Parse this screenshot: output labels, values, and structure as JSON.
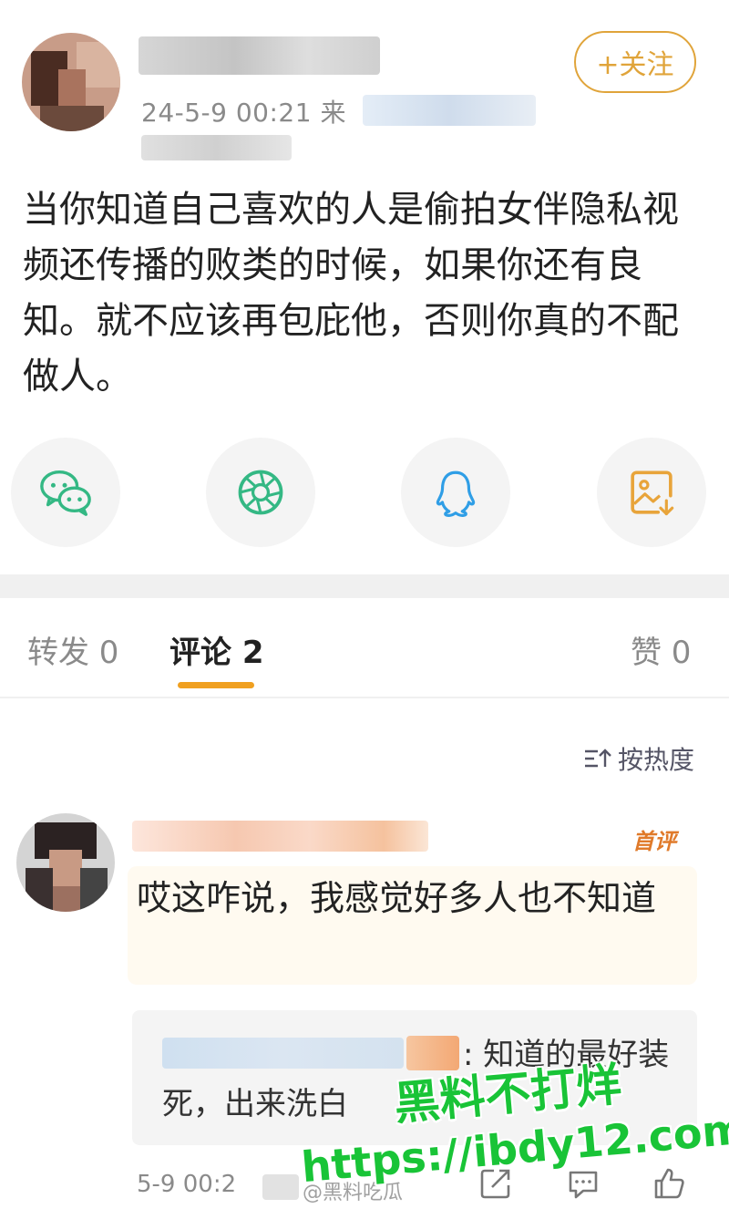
{
  "post": {
    "timestamp": "24-5-9 00:21",
    "source_prefix": "来",
    "follow_label": "+关注",
    "body": "当你知道自己喜欢的人是偷拍女伴隐私视频还传播的败类的时候，如果你还有良知。就不应该再包庇他，否则你真的不配做人。"
  },
  "share": {
    "items": [
      {
        "name": "wechat-icon",
        "color": "#34b884"
      },
      {
        "name": "moments-icon",
        "color": "#34b884"
      },
      {
        "name": "qq-icon",
        "color": "#2f9ee6"
      },
      {
        "name": "save-image-icon",
        "color": "#e8a43a"
      }
    ]
  },
  "tabs": {
    "repost": "转发 0",
    "comments": "评论 2",
    "likes": "赞 0",
    "active": "comments"
  },
  "sort": {
    "label": "按热度"
  },
  "comment": {
    "badge": "首评",
    "text": "哎这咋说，我感觉好多人也不知道",
    "reply_text": ": 知道的最好装死，出来洗白",
    "time": "5-9 00:2"
  },
  "watermark": {
    "line1": "黑料不打烊",
    "line2": "https://ibdy12.com",
    "faint": "@黑料吃瓜"
  },
  "colors": {
    "accent": "#e0a43a",
    "tab_underline": "#f0a020",
    "watermark_green": "#19c437"
  }
}
